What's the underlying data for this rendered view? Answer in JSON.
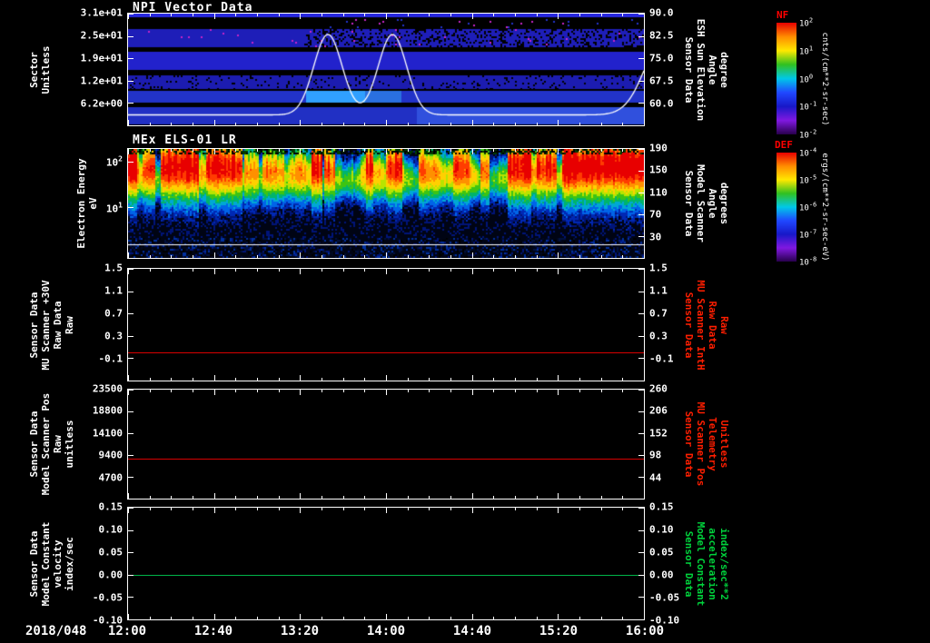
{
  "window": {
    "background": "#000000"
  },
  "x_axis": {
    "date_label": "2018/048",
    "tick_labels": [
      "12:00",
      "12:40",
      "13:20",
      "14:00",
      "14:40",
      "15:20",
      "16:00"
    ]
  },
  "chart_data": {
    "type": "heatmap",
    "subtype": "multi-panel time-series stack",
    "time_range": [
      "12:00",
      "16:00"
    ],
    "date": "2018/048",
    "panels": [
      {
        "id": "npi",
        "type": "heatmap",
        "title": "NPI Vector Data",
        "left_label_lines": [
          "Sector",
          "Unitless"
        ],
        "left_ticks": [
          "3.1e+01",
          "2.5e+01",
          "1.9e+01",
          "1.2e+01",
          "6.2e+00"
        ],
        "left_tick_fracs": [
          0,
          0.2,
          0.4,
          0.6,
          0.8
        ],
        "right_label_lines": [
          "Sensor Data",
          "ESH Sun Elevation",
          "Angle",
          "degree"
        ],
        "right_label_color": "#ffffff",
        "right_ticks": [
          "90.0",
          "82.5",
          "75.0",
          "67.5",
          "60.0"
        ],
        "right_tick_fracs": [
          0,
          0.2,
          0.4,
          0.6,
          0.8
        ],
        "seed": 7,
        "colorbar": {
          "label": "NF",
          "label_color": "#ff0000",
          "units": "cnts/(cm**2-sr-sec)",
          "ticks": [
            "10^2",
            "10^1",
            "10^0",
            "10^-1",
            "10^-2"
          ],
          "stops": [
            "#e80000",
            "#ff8c00",
            "#ffe800",
            "#30c020",
            "#00c8e8",
            "#2048ff",
            "#1818c8",
            "#8018e0",
            "#28004c"
          ]
        },
        "stripes": [
          {
            "y0": 0.0,
            "y1": 0.035,
            "color": "#2828e0"
          },
          {
            "y0": 0.045,
            "y1": 0.13,
            "mode": "speckle",
            "density": 0.04,
            "from": 0.3,
            "colors": [
              "#2233cc",
              "#c824c8",
              "#000000"
            ]
          },
          {
            "y0": 0.14,
            "y1": 0.3,
            "color": "#1e1eb8",
            "noise": 0.28,
            "noise_from": 0.34,
            "noise_color": "#000000",
            "magenta": 0.015
          },
          {
            "y0": 0.34,
            "y1": 0.5,
            "color": "#2222cc"
          },
          {
            "y0": 0.55,
            "y1": 0.675,
            "color": "#1c1cb0",
            "noise": 0.1,
            "noise_color": "#000000"
          },
          {
            "y0": 0.69,
            "y1": 0.8,
            "color": "#2233c8",
            "segments": [
              {
                "x0": 0.345,
                "x1": 0.46,
                "color": "#30a0ff"
              },
              {
                "x0": 0.46,
                "x1": 0.53,
                "color": "#2a70e0"
              }
            ]
          },
          {
            "y0": 0.84,
            "y1": 0.99,
            "color": "#2130c4",
            "segments": [
              {
                "x0": 0.56,
                "x1": 1.0,
                "color": "#3050dd"
              }
            ]
          }
        ],
        "overlay_curve": {
          "color": "#ffffff",
          "axis_top": 90,
          "axis_at_frac08": 60,
          "baseline": 56,
          "peaks": [
            {
              "center": 13.55,
              "sigma": 0.11,
              "amp": 27
            },
            {
              "center": 14.05,
              "sigma": 0.11,
              "amp": 27
            },
            {
              "center": 16.18,
              "sigma": 0.16,
              "amp": 28
            }
          ]
        }
      },
      {
        "id": "els",
        "type": "spectrogram",
        "title": "MEx ELS-01 LR",
        "left_label_lines": [
          "Electron Energy",
          "eV"
        ],
        "left_ticks": [
          "10^2",
          "10^1"
        ],
        "left_tick_fracs": [
          0.115,
          0.533
        ],
        "right_label_lines": [
          "Sensor Data",
          "Model Scanner",
          "Angle",
          "degrees"
        ],
        "right_label_color": "#ffffff",
        "right_ticks": [
          "190",
          "150",
          "110",
          "70",
          "30"
        ],
        "right_tick_fracs": [
          0,
          0.2,
          0.4,
          0.6,
          0.8
        ],
        "seed": 48,
        "white_line_frac": 0.877,
        "colorbar": {
          "label": "DEF",
          "label_color": "#ff0000",
          "units": "ergs/(cm**2-sr-sec-eV)",
          "ticks": [
            "10^-4",
            "10^-5",
            "10^-6",
            "10^-7",
            "10^-8"
          ],
          "stops": [
            "#e80000",
            "#ff8c00",
            "#ffe800",
            "#30c020",
            "#00c8e8",
            "#2048ff",
            "#1818c8",
            "#8018e0",
            "#28004c"
          ]
        },
        "active_intervals": [
          [
            0.0,
            0.015,
            0.95
          ],
          [
            0.025,
            0.05,
            0.8
          ],
          [
            0.06,
            0.135,
            0.97
          ],
          [
            0.15,
            0.22,
            0.88
          ],
          [
            0.225,
            0.25,
            0.6
          ],
          [
            0.26,
            0.3,
            0.55
          ],
          [
            0.355,
            0.375,
            0.92
          ],
          [
            0.38,
            0.4,
            0.7
          ],
          [
            0.46,
            0.475,
            0.88
          ],
          [
            0.5,
            0.53,
            0.82
          ],
          [
            0.56,
            0.6,
            0.6
          ],
          [
            0.63,
            0.66,
            0.72
          ],
          [
            0.68,
            0.7,
            0.6
          ],
          [
            0.735,
            0.78,
            0.92
          ],
          [
            0.79,
            0.83,
            0.85
          ],
          [
            0.84,
            1.0,
            0.97
          ]
        ]
      },
      {
        "id": "mu-scanner",
        "type": "line",
        "left_label_lines": [
          "Sensor Data",
          "MU Scanner +30V",
          "Raw Data",
          "Raw"
        ],
        "left_ticks": [
          "1.5",
          "1.1",
          "0.7",
          "0.3",
          "-0.1"
        ],
        "left_tick_fracs": [
          0,
          0.2,
          0.4,
          0.6,
          0.8
        ],
        "right_label_lines": [
          "Sensor Data",
          "MU Scanner IntH",
          "Raw Data",
          "Raw"
        ],
        "right_label_color": "#ff1e00",
        "right_ticks": [
          "1.5",
          "1.1",
          "0.7",
          "0.3",
          "-0.1"
        ],
        "right_tick_fracs": [
          0,
          0.2,
          0.4,
          0.6,
          0.8
        ],
        "y_range": [
          1.5,
          -0.5
        ],
        "series": [
          {
            "name": "MU Scanner +30V Raw Data",
            "value": 0.0,
            "color": "#d80000"
          }
        ]
      },
      {
        "id": "scanner-pos",
        "type": "line",
        "left_label_lines": [
          "Sensor Data",
          "Model Scanner Pos",
          "Raw",
          "unitless"
        ],
        "left_ticks": [
          "23500",
          "18800",
          "14100",
          "9400",
          "4700"
        ],
        "left_tick_fracs": [
          0,
          0.2,
          0.4,
          0.6,
          0.8
        ],
        "right_label_lines": [
          "Sensor Data",
          "MU Scanner Pos",
          "Telemetry",
          "Unitless"
        ],
        "right_label_color": "#ff1e00",
        "right_ticks": [
          "260",
          "206",
          "152",
          "98",
          "44"
        ],
        "right_tick_fracs": [
          0,
          0.2,
          0.4,
          0.6,
          0.8
        ],
        "y_range": [
          23500,
          0
        ],
        "series": [
          {
            "name": "Model Scanner Pos Raw",
            "value": 8700,
            "color": "#d80000"
          }
        ]
      },
      {
        "id": "model-constant",
        "type": "line",
        "left_label_lines": [
          "Sensor Data",
          "Model Constant",
          "velocity",
          "index/sec"
        ],
        "left_ticks": [
          "0.15",
          "0.10",
          "0.05",
          "0.00",
          "-0.05",
          "-0.10"
        ],
        "left_tick_fracs": [
          0,
          0.2,
          0.4,
          0.6,
          0.8,
          1
        ],
        "right_label_lines": [
          "Sensor Data",
          "Model Constant",
          "acceleration",
          "index/sec**2"
        ],
        "right_label_color": "#00d23c",
        "right_ticks": [
          "0.15",
          "0.10",
          "0.05",
          "0.00",
          "-0.05",
          "-0.10"
        ],
        "right_tick_fracs": [
          0,
          0.2,
          0.4,
          0.6,
          0.8,
          1
        ],
        "y_range": [
          0.15,
          -0.1
        ],
        "series": [
          {
            "name": "Model Constant velocity",
            "value": 0.0,
            "color": "#00b44a"
          }
        ]
      }
    ]
  }
}
